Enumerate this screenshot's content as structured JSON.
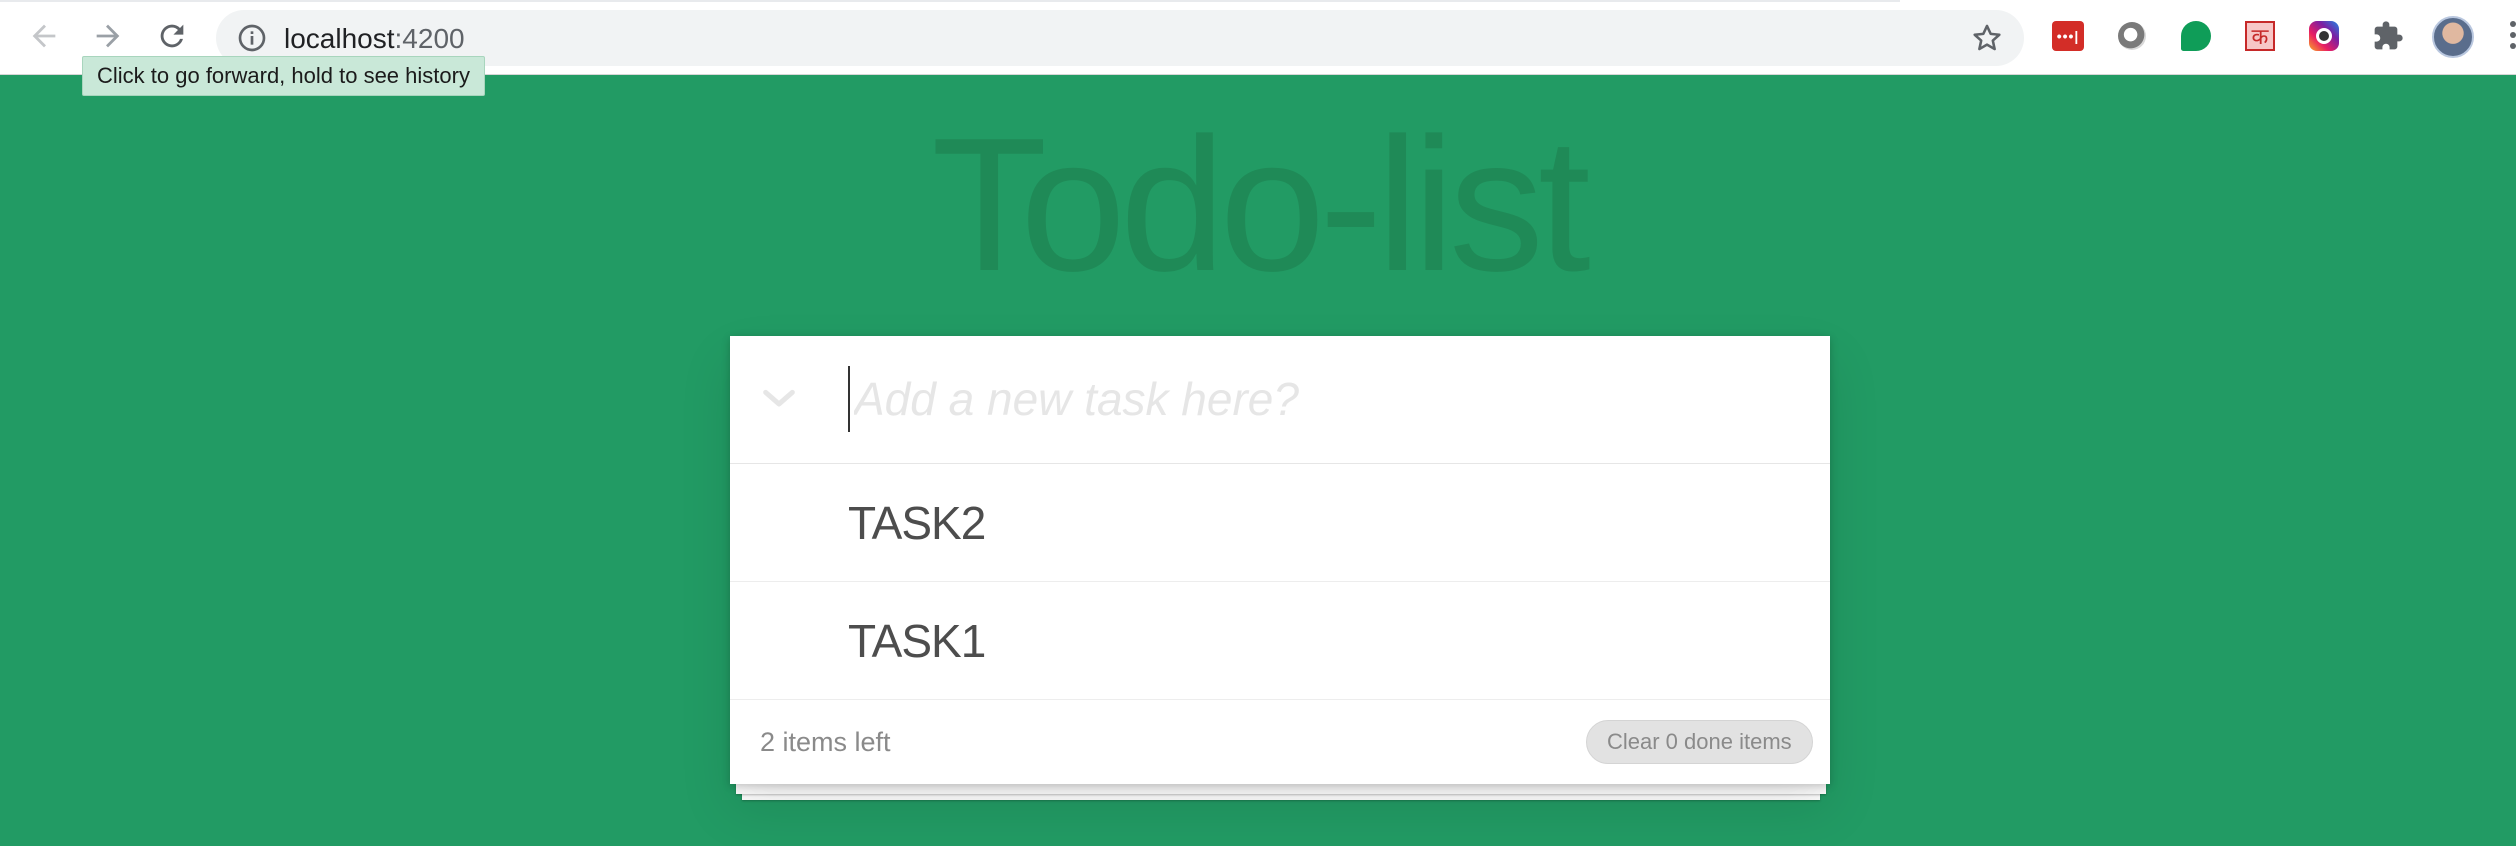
{
  "browser": {
    "url_host": "localhost",
    "url_port": ":4200",
    "tooltip": "Click to go forward, hold to see history",
    "extensions": [
      "lastpass-icon",
      "ring-extension-icon",
      "hangouts-icon",
      "hindi-ka-icon",
      "camera-extension-icon",
      "puzzle-icon"
    ]
  },
  "app": {
    "title": "Todo-list",
    "new_task_placeholder": "Add a new task here?",
    "new_task_value": "",
    "tasks": [
      {
        "label": "TASK2",
        "done": false
      },
      {
        "label": "TASK1",
        "done": false
      }
    ],
    "footer": {
      "items_left": "2 items left",
      "clear_button": "Clear 0 done items"
    }
  },
  "colors": {
    "background": "#229b64",
    "title": "#1f8a57",
    "card": "#ffffff"
  }
}
